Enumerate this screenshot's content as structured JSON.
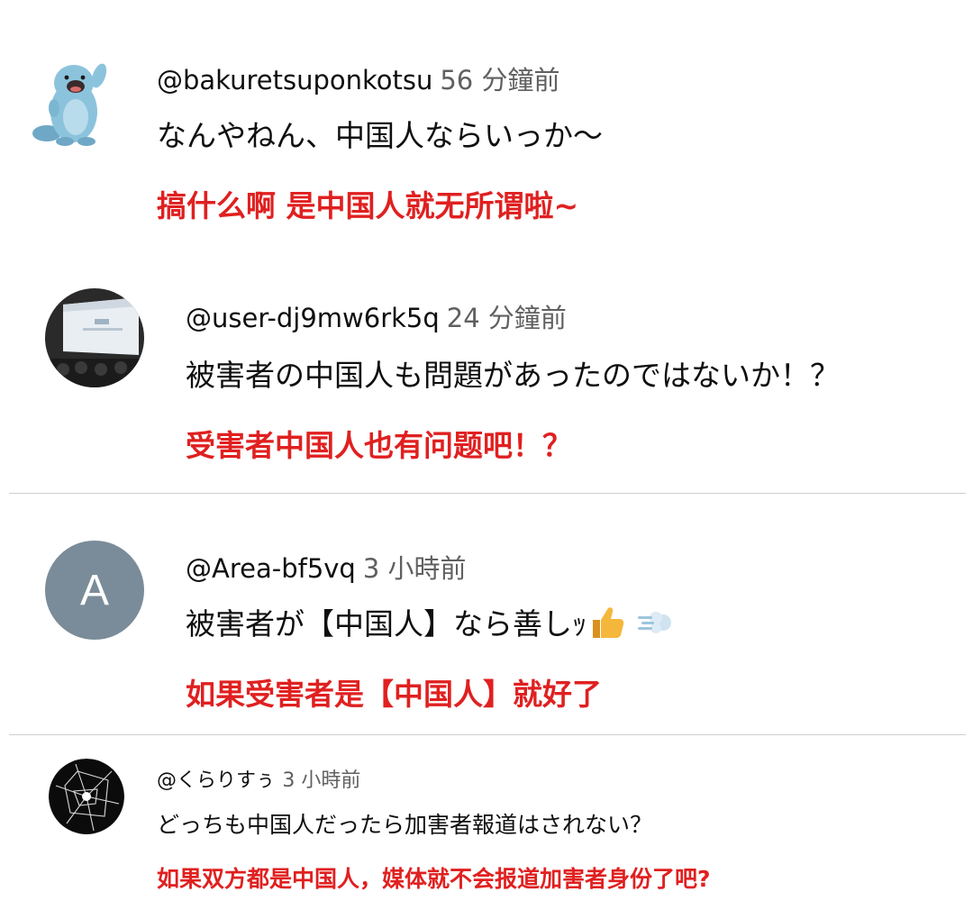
{
  "comments": [
    {
      "handle": "@bakuretsuponkotsu",
      "time": "56 分鐘前",
      "text": "なんやねん、中国人ならいっか～",
      "translation": "搞什么啊 是中国人就无所谓啦~",
      "avatar": "quagsire-icon"
    },
    {
      "handle": "@user-dj9mw6rk5q",
      "time": "24 分鐘前",
      "text": "被害者の中国人も問題があったのではないか！？",
      "translation": "受害者中国人也有问题吧！？",
      "avatar": "stage-photo"
    },
    {
      "handle": "@Area-bf5vq",
      "time": "3 小時前",
      "text": "被害者が【中国人】なら善しｯ",
      "emojis": [
        "thumbs-up-icon",
        "dash-icon"
      ],
      "translation": "如果受害者是【中国人】就好了",
      "avatar_letter": "A",
      "avatar_color": "#7a8c99"
    },
    {
      "handle": "@くらりすぅ",
      "time": "3 小時前",
      "text": "どっちも中国人だったら加害者報道はされない？",
      "translation": "如果双方都是中国人，媒体就不会报道加害者身份了吧?",
      "avatar": "cracked-glass-icon"
    }
  ],
  "colors": {
    "translation": "#e02020",
    "handle": "#0f0f0f",
    "time": "#606060"
  }
}
